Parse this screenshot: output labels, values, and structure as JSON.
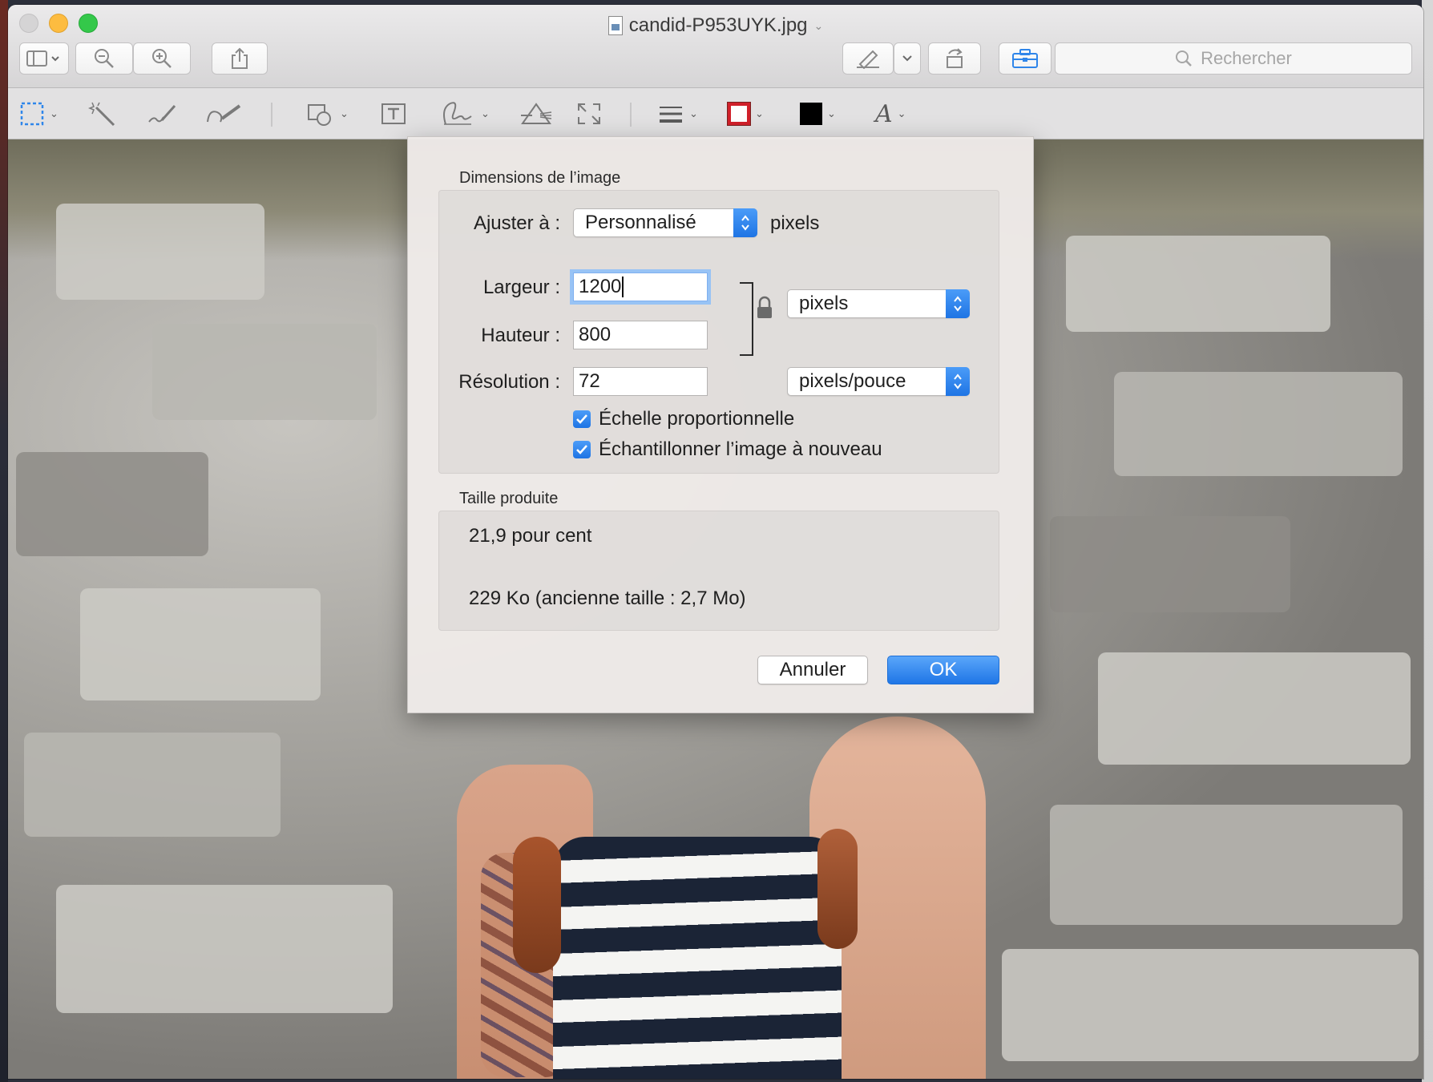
{
  "window": {
    "title": "candid-P953UYK.jpg"
  },
  "toolbar": {
    "search_placeholder": "Rechercher",
    "accent_color": "#1e74e4"
  },
  "markup": {
    "border_color": "#d0202a",
    "fill_color": "#000000",
    "font_glyph": "A"
  },
  "dialog": {
    "dimensions_group_label": "Dimensions de l’image",
    "fit_label": "Ajuster à :",
    "fit_value": "Personnalisé",
    "fit_unit": "pixels",
    "width_label": "Largeur :",
    "width_value": "1200",
    "height_label": "Hauteur :",
    "height_value": "800",
    "size_unit_value": "pixels",
    "resolution_label": "Résolution :",
    "resolution_value": "72",
    "resolution_unit_value": "pixels/pouce",
    "scale_proportionally_label": "Échelle proportionnelle",
    "scale_proportionally_checked": true,
    "resample_label": "Échantillonner l’image à nouveau",
    "resample_checked": true,
    "result_group_label": "Taille produite",
    "result_percent": "21,9 pour cent",
    "result_size": "229 Ko (ancienne taille : 2,7 Mo)",
    "cancel_label": "Annuler",
    "ok_label": "OK"
  }
}
